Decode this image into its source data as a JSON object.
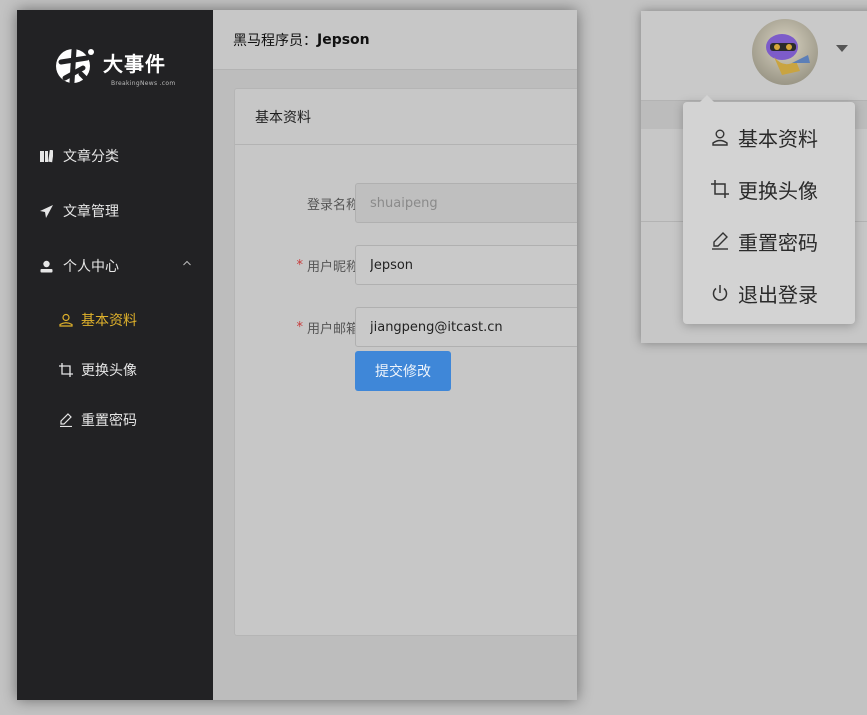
{
  "sidebar": {
    "logo": {
      "title": "大事件",
      "subtitle": "BreakingNews .com"
    },
    "nav": [
      {
        "label": "文章分类",
        "icon": "category-icon"
      },
      {
        "label": "文章管理",
        "icon": "paper-plane-icon"
      },
      {
        "label": "个人中心",
        "icon": "user-icon",
        "expanded": true
      }
    ],
    "sub_items": [
      {
        "label": "基本资料",
        "icon": "user-outline-icon",
        "active": true
      },
      {
        "label": "更换头像",
        "icon": "crop-icon"
      },
      {
        "label": "重置密码",
        "icon": "edit-pen-icon"
      }
    ],
    "active_color": "#e0b22b"
  },
  "header": {
    "prefix": "黑马程序员：",
    "username": "Jepson"
  },
  "card": {
    "title": "基本资料",
    "fields": [
      {
        "label": "登录名称",
        "required": false,
        "value": "shuaipeng",
        "disabled": true
      },
      {
        "label": "用户昵称",
        "required": true,
        "value": "Jepson",
        "disabled": false
      },
      {
        "label": "用户邮箱",
        "required": true,
        "value": "jiangpeng@itcast.cn",
        "disabled": false
      }
    ],
    "required_mark": "*",
    "submit_label": "提交修改",
    "primary_color": "#3f87d8"
  },
  "dropdown": {
    "items": [
      {
        "label": "基本资料",
        "icon": "user-outline-icon"
      },
      {
        "label": "更换头像",
        "icon": "crop-icon"
      },
      {
        "label": "重置密码",
        "icon": "edit-pen-icon"
      },
      {
        "label": "退出登录",
        "icon": "power-icon"
      }
    ]
  }
}
